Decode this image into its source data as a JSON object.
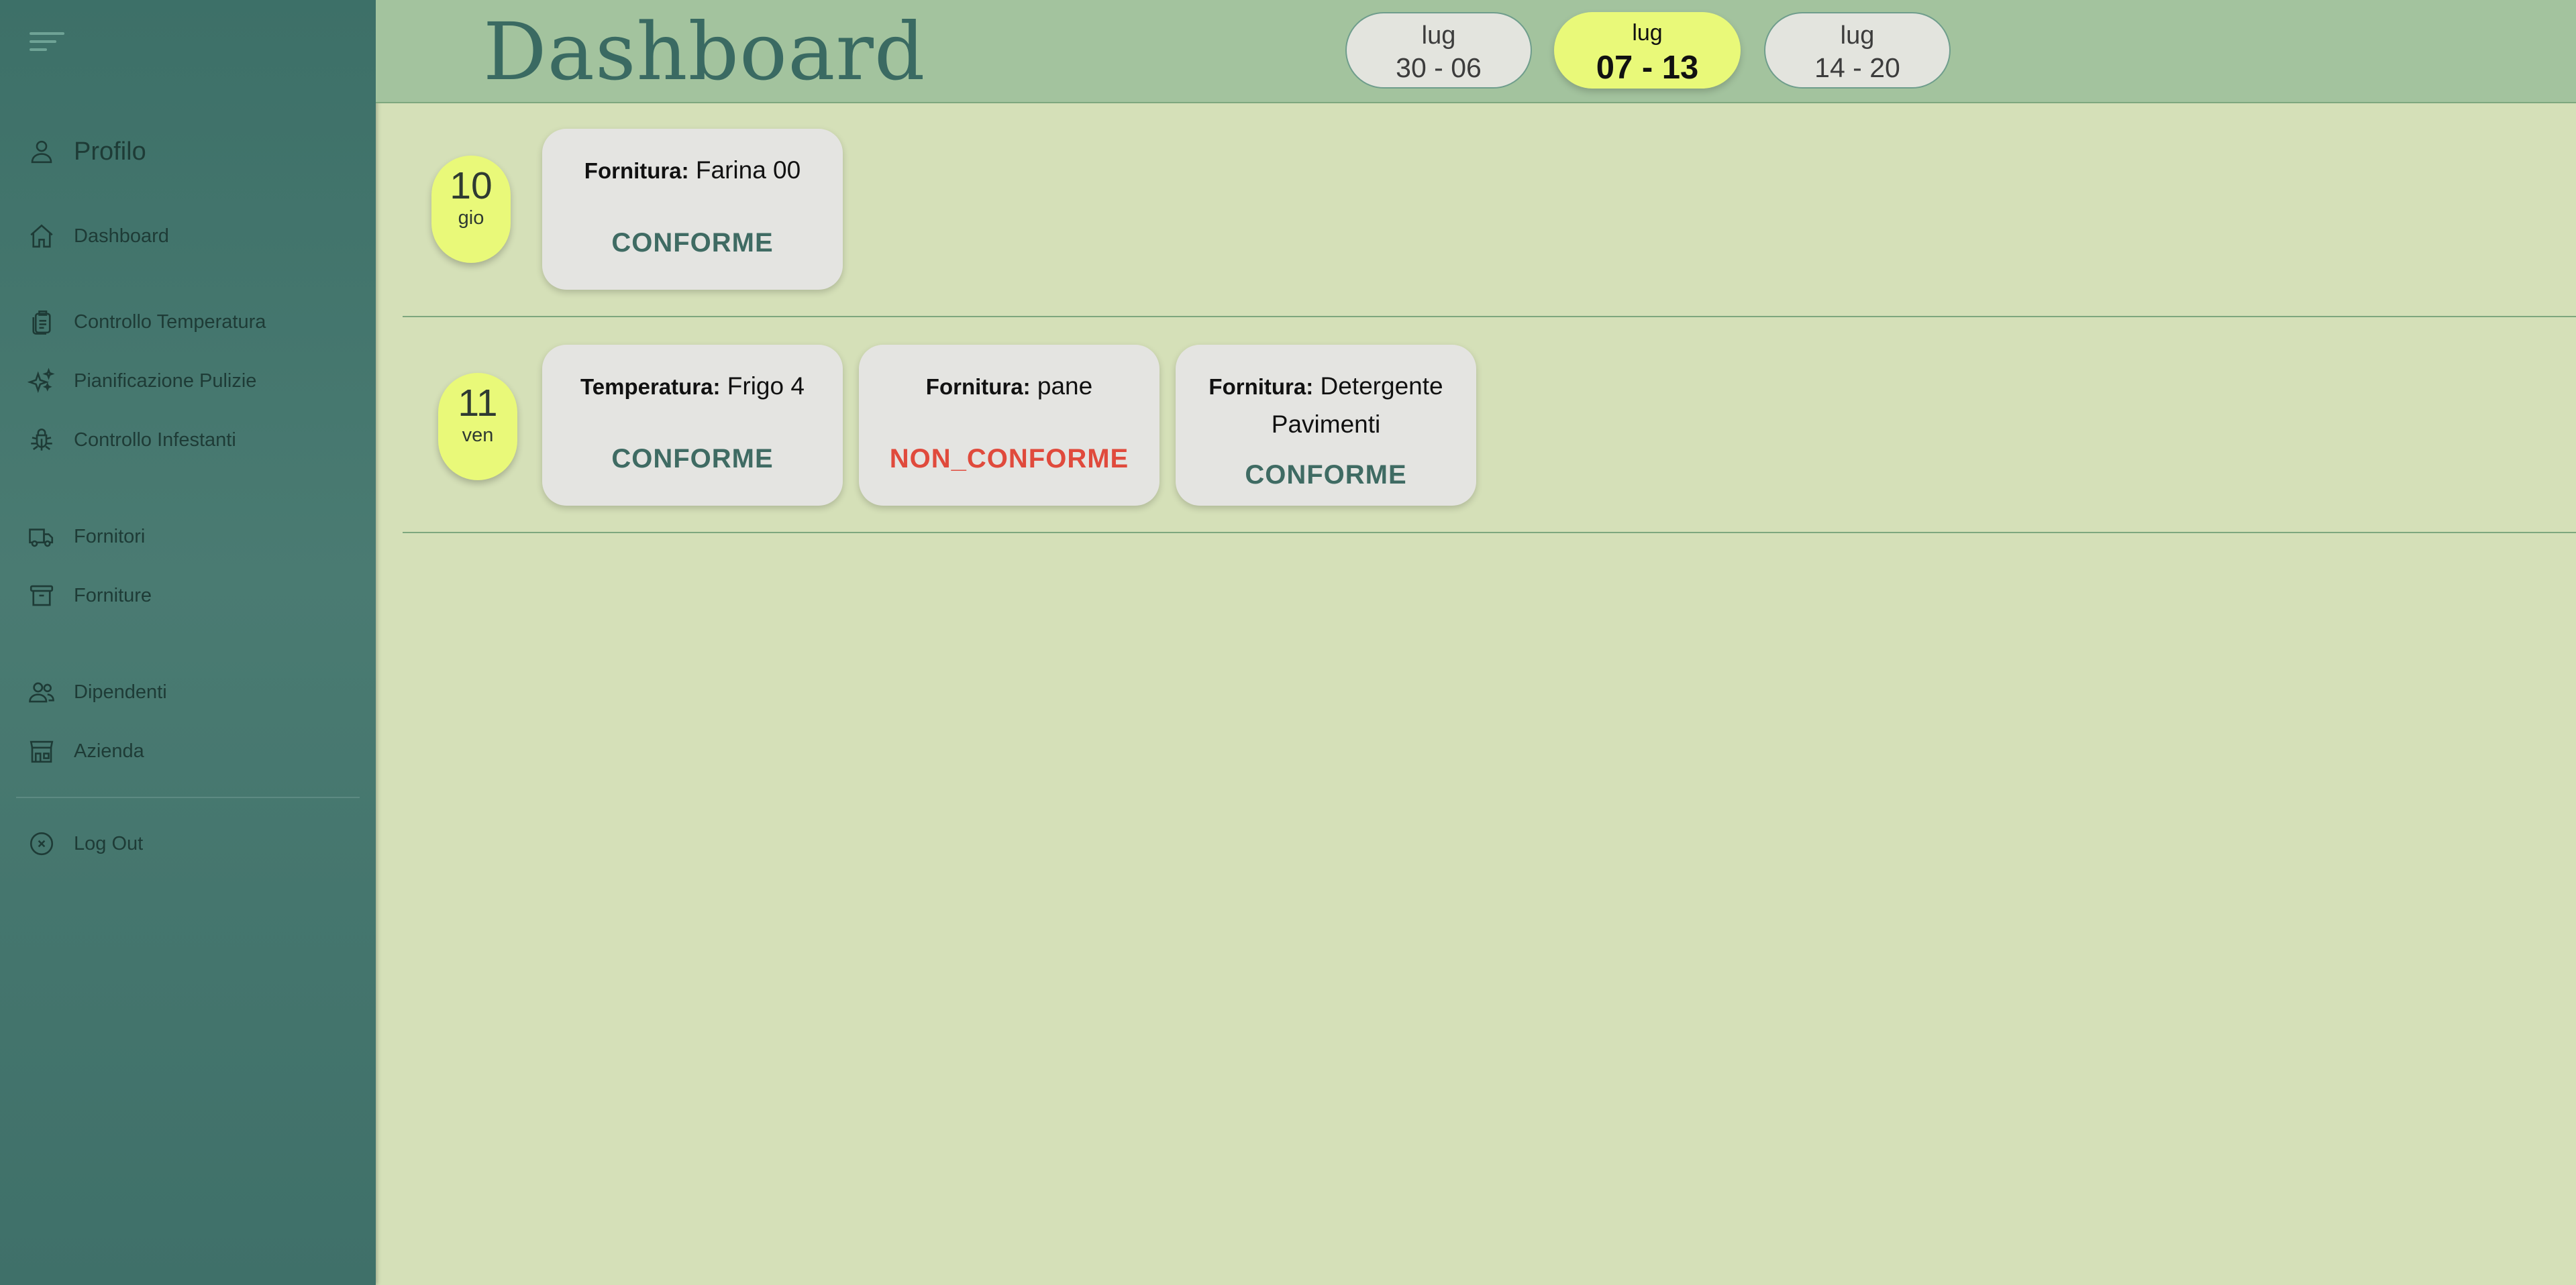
{
  "sidebar": {
    "profile": {
      "label": "Profilo",
      "icon": "user-icon"
    },
    "items": [
      {
        "label": "Dashboard",
        "icon": "home-icon"
      },
      {
        "label": "Controllo Temperatura",
        "icon": "clipboard-icon"
      },
      {
        "label": "Pianificazione Pulizie",
        "icon": "sparkles-icon"
      },
      {
        "label": "Controllo Infestanti",
        "icon": "bug-icon"
      },
      {
        "label": "Fornitori",
        "icon": "truck-icon"
      },
      {
        "label": "Forniture",
        "icon": "archive-box-icon"
      },
      {
        "label": "Dipendenti",
        "icon": "users-icon"
      },
      {
        "label": "Azienda",
        "icon": "building-storefront-icon"
      }
    ],
    "logout": {
      "label": "Log Out",
      "icon": "x-circle-icon"
    }
  },
  "header": {
    "title": "Dashboard",
    "weeks": [
      {
        "month": "lug",
        "range": "30 - 06",
        "active": false
      },
      {
        "month": "lug",
        "range": "07 - 13",
        "active": true
      },
      {
        "month": "lug",
        "range": "14 - 20",
        "active": false
      }
    ]
  },
  "days": [
    {
      "number": "10",
      "weekday": "gio",
      "cards": [
        {
          "type": "Fornitura:",
          "name": "Farina 00",
          "status": "CONFORME"
        }
      ]
    },
    {
      "number": "11",
      "weekday": "ven",
      "cards": [
        {
          "type": "Temperatura:",
          "name": "Frigo 4",
          "status": "CONFORME"
        },
        {
          "type": "Fornitura:",
          "name": "pane",
          "status": "NON_CONFORME"
        },
        {
          "type": "Fornitura:",
          "name": "Detergente Pavimenti",
          "status": "CONFORME"
        }
      ]
    }
  ],
  "colors": {
    "accent": "#e9f979",
    "ok": "#3f6b63",
    "ko": "#e04a3c",
    "sidebar": "#3d7068"
  }
}
